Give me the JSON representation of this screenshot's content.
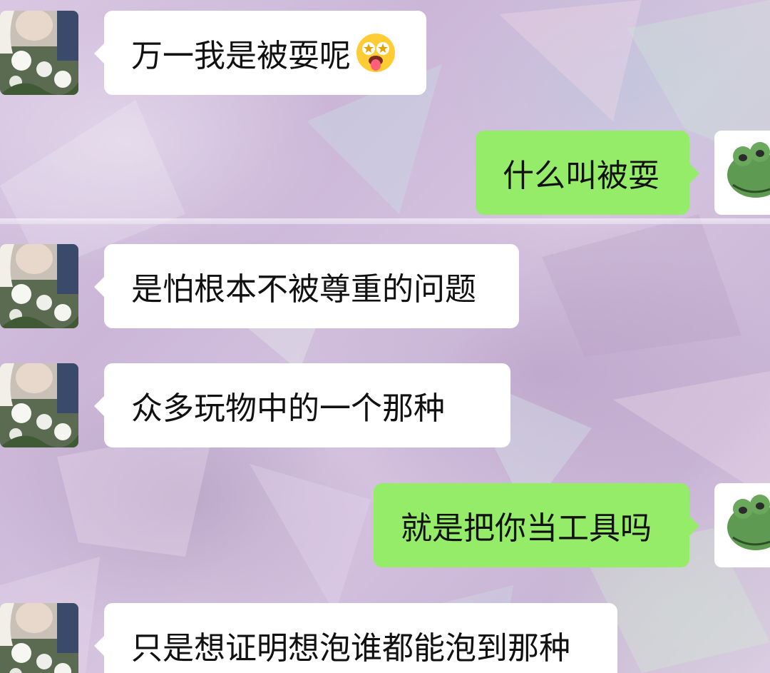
{
  "theme": {
    "incoming_bubble_color": "#ffffff",
    "outgoing_bubble_color": "#95ec69",
    "background_tint": "#d6c4e0"
  },
  "contact": {
    "avatar_icon": "flower-portrait-avatar-icon"
  },
  "me": {
    "avatar_icon": "green-frog-avatar-icon"
  },
  "messages": [
    {
      "side": "in",
      "text": "万一我是被耍呢",
      "emoji": "star-eyes-tongue-emoji"
    },
    {
      "side": "out",
      "text": "什么叫被耍"
    },
    {
      "side": "in",
      "text": "是怕根本不被尊重的问题"
    },
    {
      "side": "in",
      "text": "众多玩物中的一个那种"
    },
    {
      "side": "out",
      "text": "就是把你当工具吗"
    },
    {
      "side": "in",
      "text": "只是想证明想泡谁都能泡到那种"
    }
  ]
}
